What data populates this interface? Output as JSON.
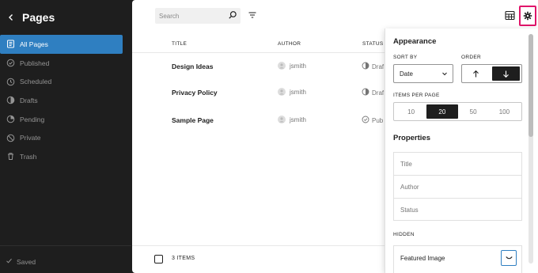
{
  "sidebar": {
    "title": "Pages",
    "items": [
      {
        "label": "All Pages",
        "icon": "pages-icon",
        "active": true
      },
      {
        "label": "Published",
        "icon": "published-icon"
      },
      {
        "label": "Scheduled",
        "icon": "scheduled-icon"
      },
      {
        "label": "Drafts",
        "icon": "drafts-icon"
      },
      {
        "label": "Pending",
        "icon": "pending-icon"
      },
      {
        "label": "Private",
        "icon": "private-icon"
      },
      {
        "label": "Trash",
        "icon": "trash-icon"
      }
    ],
    "footer": "Saved"
  },
  "toolbar": {
    "search_placeholder": "Search"
  },
  "table": {
    "columns": [
      "TITLE",
      "AUTHOR",
      "STATUS"
    ],
    "rows": [
      {
        "title": "Design Ideas",
        "author": "jsmith",
        "status": "Draf"
      },
      {
        "title": "Privacy Policy",
        "author": "jsmith",
        "status": "Draf"
      },
      {
        "title": "Sample Page",
        "author": "jsmith",
        "status": "Pub"
      }
    ],
    "count_label": "3 ITEMS"
  },
  "popover": {
    "appearance_heading": "Appearance",
    "sort_by_label": "SORT BY",
    "sort_by_value": "Date",
    "order_label": "ORDER",
    "items_per_page_label": "ITEMS PER PAGE",
    "items_per_page_options": [
      "10",
      "20",
      "50",
      "100"
    ],
    "items_per_page_selected": "20",
    "properties_heading": "Properties",
    "properties": [
      "Title",
      "Author",
      "Status"
    ],
    "hidden_label": "HIDDEN",
    "hidden_items": [
      "Featured Image"
    ]
  },
  "colors": {
    "accent": "#2f7fc1",
    "highlight": "#e0156a",
    "sidebar_bg": "#1e1e1e"
  }
}
